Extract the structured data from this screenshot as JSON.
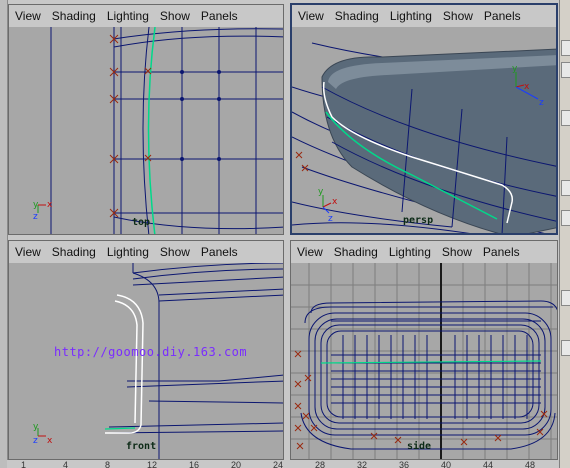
{
  "menus": [
    "View",
    "Shading",
    "Lighting",
    "Show",
    "Panels"
  ],
  "panes": {
    "top": {
      "camera": "top"
    },
    "persp": {
      "camera": "persp"
    },
    "front": {
      "camera": "front",
      "watermark": "http://goomoo.diy.163.com"
    },
    "side": {
      "camera": "side"
    }
  },
  "axis": {
    "x": "x",
    "y": "y",
    "z": "z"
  },
  "timeline_ticks": [
    "1",
    "4",
    "8",
    "12",
    "16",
    "20",
    "24",
    "28",
    "32",
    "36",
    "40",
    "44",
    "48"
  ],
  "colors": {
    "viewport_bg": "#a7a7a7",
    "curve": "#0b1670",
    "active_border": "#2a3f6b",
    "selected_curve": "#00d98a",
    "highlight_curve": "#ffffff",
    "model_surface": "#5a6a7a"
  }
}
